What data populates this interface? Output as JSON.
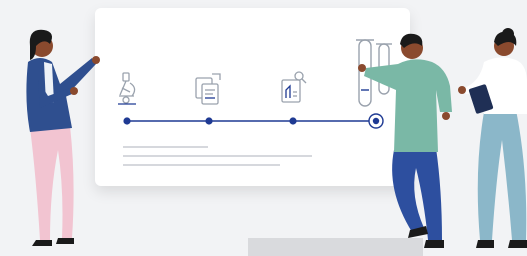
{
  "illustration": {
    "colors": {
      "background": "#f2f3f5",
      "board": "#ffffff",
      "timeline": "#1f3a93",
      "icon_stroke": "#9aa2ad",
      "text_line": "#c9ccd2",
      "pedestal": "#d9dadd",
      "person_left_jacket": "#2f4f8f",
      "person_left_pants": "#f2c4d1",
      "person_middle_shirt": "#7ab8a6",
      "person_middle_pants": "#2d4f9f",
      "person_right_top": "#ffffff",
      "person_right_pants": "#8bb7c9",
      "skin": "#8a4a2e",
      "hair": "#1a1a1a"
    },
    "steps": [
      {
        "icon": "microscope-icon"
      },
      {
        "icon": "documents-icon"
      },
      {
        "icon": "lab-report-icon"
      },
      {
        "icon": "test-tubes-icon"
      }
    ]
  }
}
